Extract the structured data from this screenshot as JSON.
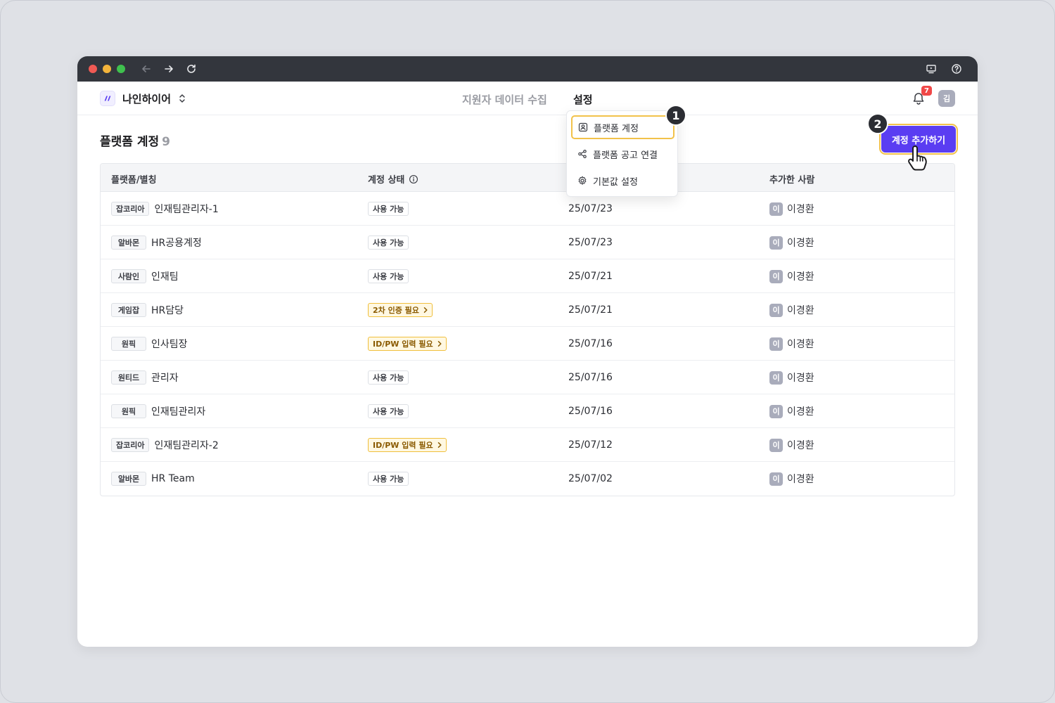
{
  "brand": {
    "name": "나인하이어"
  },
  "topnav": {
    "collect": "지원자 데이터 수집",
    "settings": "설정"
  },
  "notifications": {
    "count": "7"
  },
  "user": {
    "initial": "김"
  },
  "page": {
    "title": "플랫폼 계정",
    "count": "9"
  },
  "add_button": {
    "label": "계정 추가하기"
  },
  "steps": {
    "first": "1",
    "second": "2"
  },
  "dropdown": {
    "items": [
      {
        "label": "플랫폼 계정",
        "icon": "account-icon"
      },
      {
        "label": "플랫폼 공고 연결",
        "icon": "share-icon"
      },
      {
        "label": "기본값 설정",
        "icon": "gear-icon"
      }
    ]
  },
  "table": {
    "headers": [
      "플랫폼/별칭",
      "계정 상태",
      "추가한 사람"
    ],
    "rows": [
      {
        "platform": "잡코리아",
        "alias": "인재팀관리자-1",
        "status": "사용 가능",
        "status_type": "ok",
        "date": "25/07/23",
        "user_initial": "이",
        "user": "이경환"
      },
      {
        "platform": "알바몬",
        "alias": "HR공용계정",
        "status": "사용 가능",
        "status_type": "ok",
        "date": "25/07/23",
        "user_initial": "이",
        "user": "이경환"
      },
      {
        "platform": "사람인",
        "alias": "인재팀",
        "status": "사용 가능",
        "status_type": "ok",
        "date": "25/07/21",
        "user_initial": "이",
        "user": "이경환"
      },
      {
        "platform": "게임잡",
        "alias": "HR담당",
        "status": "2차 인증 필요",
        "status_type": "warn",
        "date": "25/07/21",
        "user_initial": "이",
        "user": "이경환"
      },
      {
        "platform": "원픽",
        "alias": "인사팀장",
        "status": "ID/PW 입력 필요",
        "status_type": "warn",
        "date": "25/07/16",
        "user_initial": "이",
        "user": "이경환"
      },
      {
        "platform": "원티드",
        "alias": "관리자",
        "status": "사용 가능",
        "status_type": "ok",
        "date": "25/07/16",
        "user_initial": "이",
        "user": "이경환"
      },
      {
        "platform": "원픽",
        "alias": "인재팀관리자",
        "status": "사용 가능",
        "status_type": "ok",
        "date": "25/07/16",
        "user_initial": "이",
        "user": "이경환"
      },
      {
        "platform": "잡코리아",
        "alias": "인재팀관리자-2",
        "status": "ID/PW 입력 필요",
        "status_type": "warn",
        "date": "25/07/12",
        "user_initial": "이",
        "user": "이경환"
      },
      {
        "platform": "알바몬",
        "alias": "HR Team",
        "status": "사용 가능",
        "status_type": "ok",
        "date": "25/07/02",
        "user_initial": "이",
        "user": "이경환"
      }
    ]
  },
  "colors": {
    "accent": "#5a3df2",
    "highlight": "#f2c24a",
    "warn_bg": "#fff8e2",
    "titlebar": "#33363d"
  }
}
